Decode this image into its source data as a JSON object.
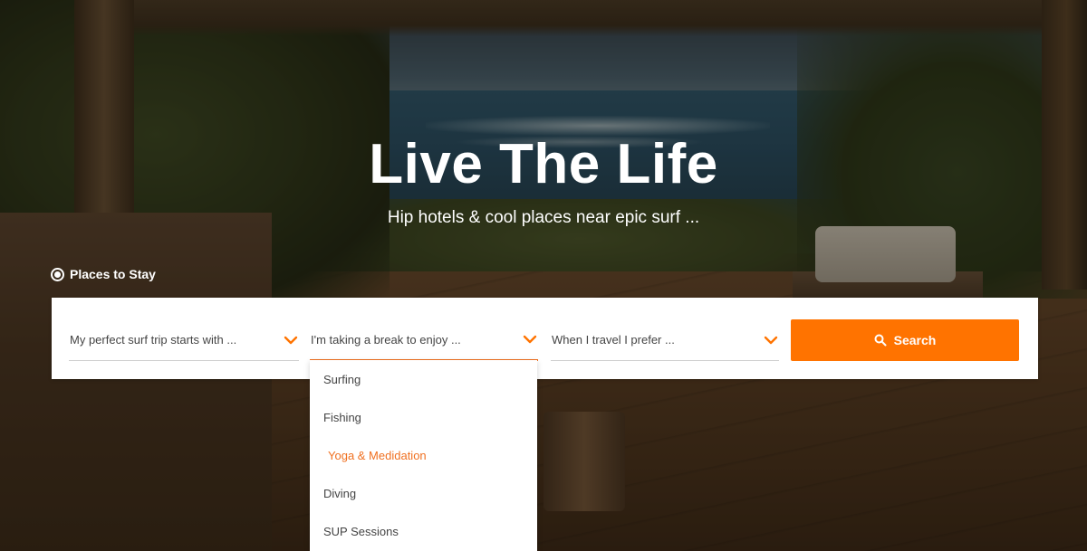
{
  "hero": {
    "title": "Live The Life",
    "subtitle": "Hip hotels & cool places near epic surf ..."
  },
  "places_toggle": {
    "label": "Places to Stay",
    "selected": true
  },
  "search": {
    "selects": [
      {
        "label": "My perfect surf trip starts with ..."
      },
      {
        "label": "I'm taking a break to enjoy ...",
        "open": true
      },
      {
        "label": "When I travel I prefer ..."
      }
    ],
    "button_label": "Search"
  },
  "dropdown": {
    "items": [
      {
        "label": "Surfing"
      },
      {
        "label": "Fishing"
      },
      {
        "label": "Yoga & Medidation",
        "highlighted": true
      },
      {
        "label": "Diving"
      },
      {
        "label": "SUP Sessions"
      }
    ]
  },
  "colors": {
    "accent": "#ff7300",
    "text": "#444444",
    "white": "#ffffff"
  },
  "icons": {
    "places_toggle": "radio-selected-icon",
    "select_chevron": "chevron-down-icon",
    "search": "search-icon"
  }
}
